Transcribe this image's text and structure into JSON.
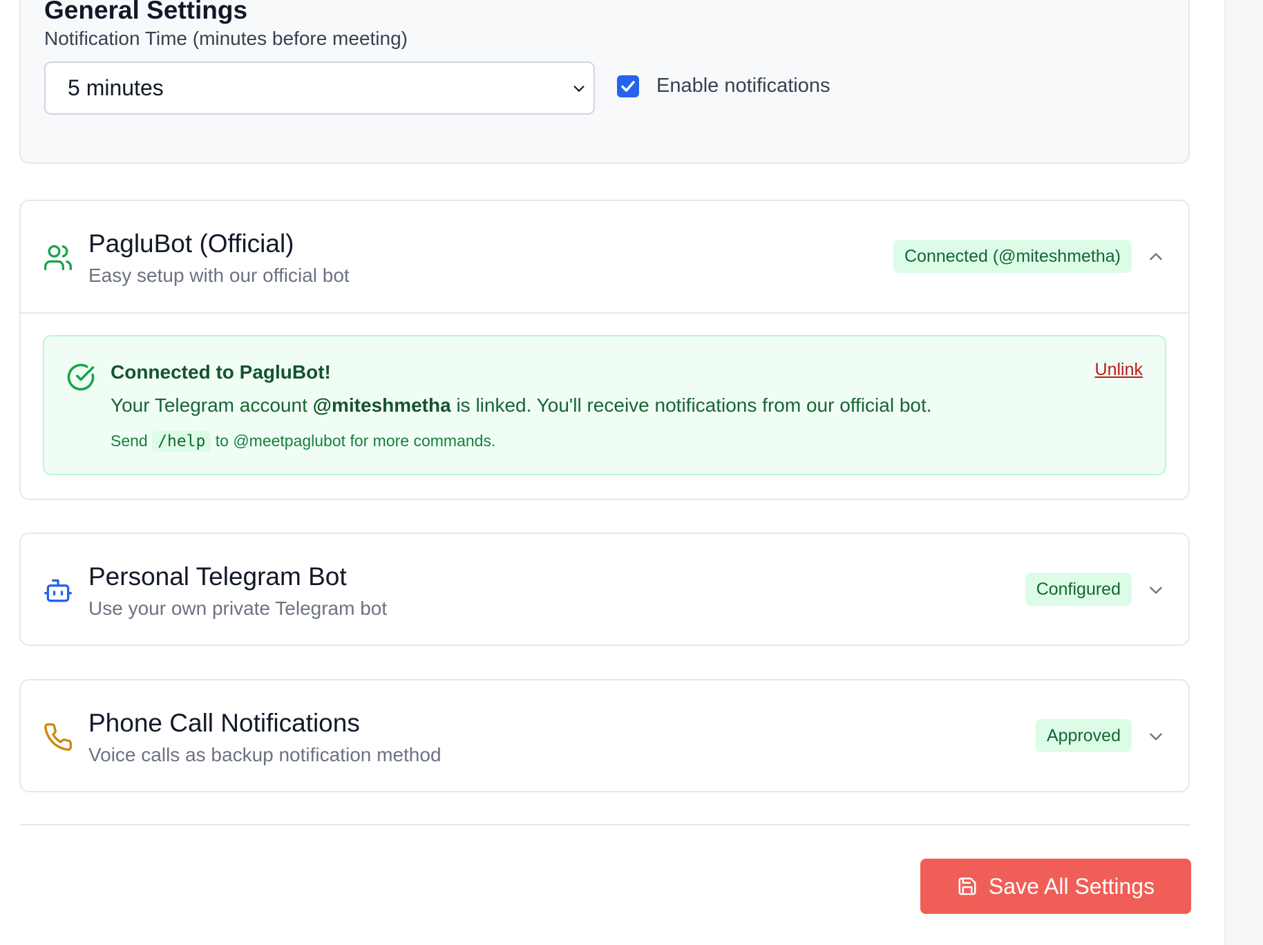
{
  "general": {
    "title": "General Settings",
    "notification_time_label": "Notification Time (minutes before meeting)",
    "notification_time_value": "5 minutes",
    "enable_notifications_label": "Enable notifications",
    "enable_notifications_checked": true
  },
  "methods": [
    {
      "title": "PagluBot (Official)",
      "subtitle": "Easy setup with our official bot",
      "badge": "Connected (@miteshmetha)",
      "icon": "users-icon",
      "icon_color": "#16a34a",
      "expanded": true,
      "connected_panel": {
        "title": "Connected to PagluBot!",
        "message_prefix": "Your Telegram account ",
        "username": "@miteshmetha",
        "message_suffix": " is linked. You'll receive notifications from our official bot.",
        "hint_prefix": "Send ",
        "hint_command": "/help",
        "hint_suffix": " to @meetpaglubot for more commands.",
        "unlink_label": "Unlink"
      }
    },
    {
      "title": "Personal Telegram Bot",
      "subtitle": "Use your own private Telegram bot",
      "badge": "Configured",
      "icon": "bot-icon",
      "icon_color": "#2563eb",
      "expanded": false
    },
    {
      "title": "Phone Call Notifications",
      "subtitle": "Voice calls as backup notification method",
      "badge": "Approved",
      "icon": "phone-icon",
      "icon_color": "#ca8a04",
      "expanded": false
    }
  ],
  "footer": {
    "save_label": "Save All Settings",
    "save_icon": "save-icon",
    "save_color": "#ef5f57"
  }
}
